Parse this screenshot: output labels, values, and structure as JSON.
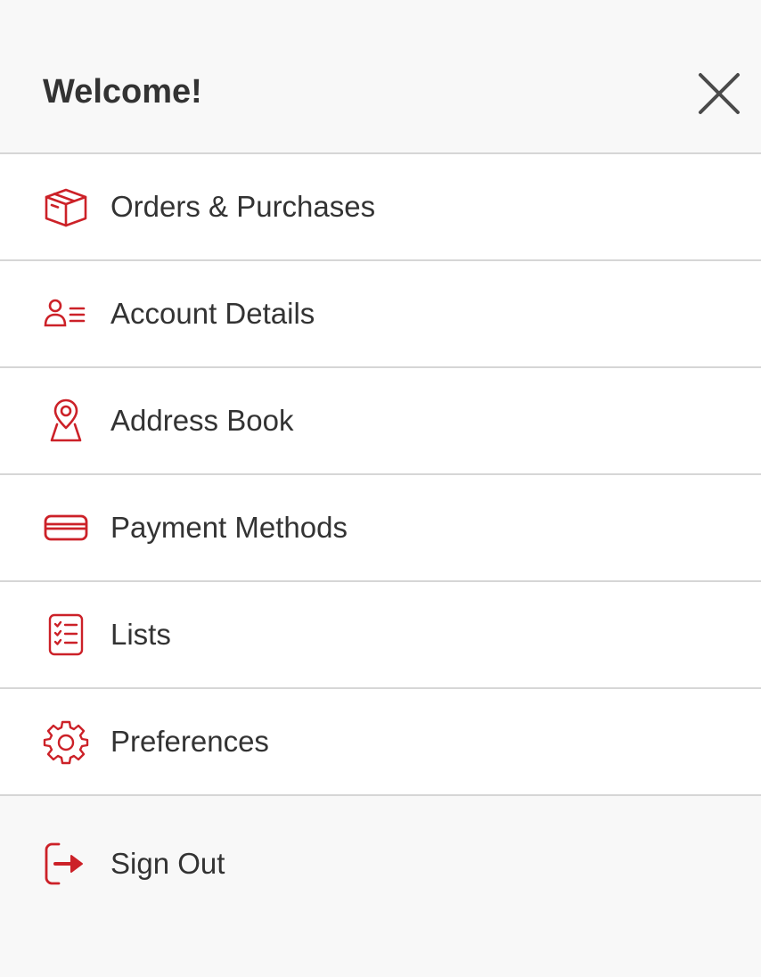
{
  "header": {
    "title": "Welcome!",
    "close_icon": "close-icon"
  },
  "colors": {
    "accent": "#cc2128",
    "text": "#333333",
    "divider": "#d6d6d6",
    "background": "#f8f8f8"
  },
  "menu": {
    "items": [
      {
        "label": "Orders & Purchases",
        "icon": "box-icon"
      },
      {
        "label": "Account Details",
        "icon": "user-list-icon"
      },
      {
        "label": "Address Book",
        "icon": "location-pin-icon"
      },
      {
        "label": "Payment Methods",
        "icon": "credit-card-icon"
      },
      {
        "label": "Lists",
        "icon": "checklist-icon"
      },
      {
        "label": "Preferences",
        "icon": "gear-icon"
      }
    ]
  },
  "footer": {
    "signout_label": "Sign Out",
    "signout_icon": "sign-out-icon"
  }
}
